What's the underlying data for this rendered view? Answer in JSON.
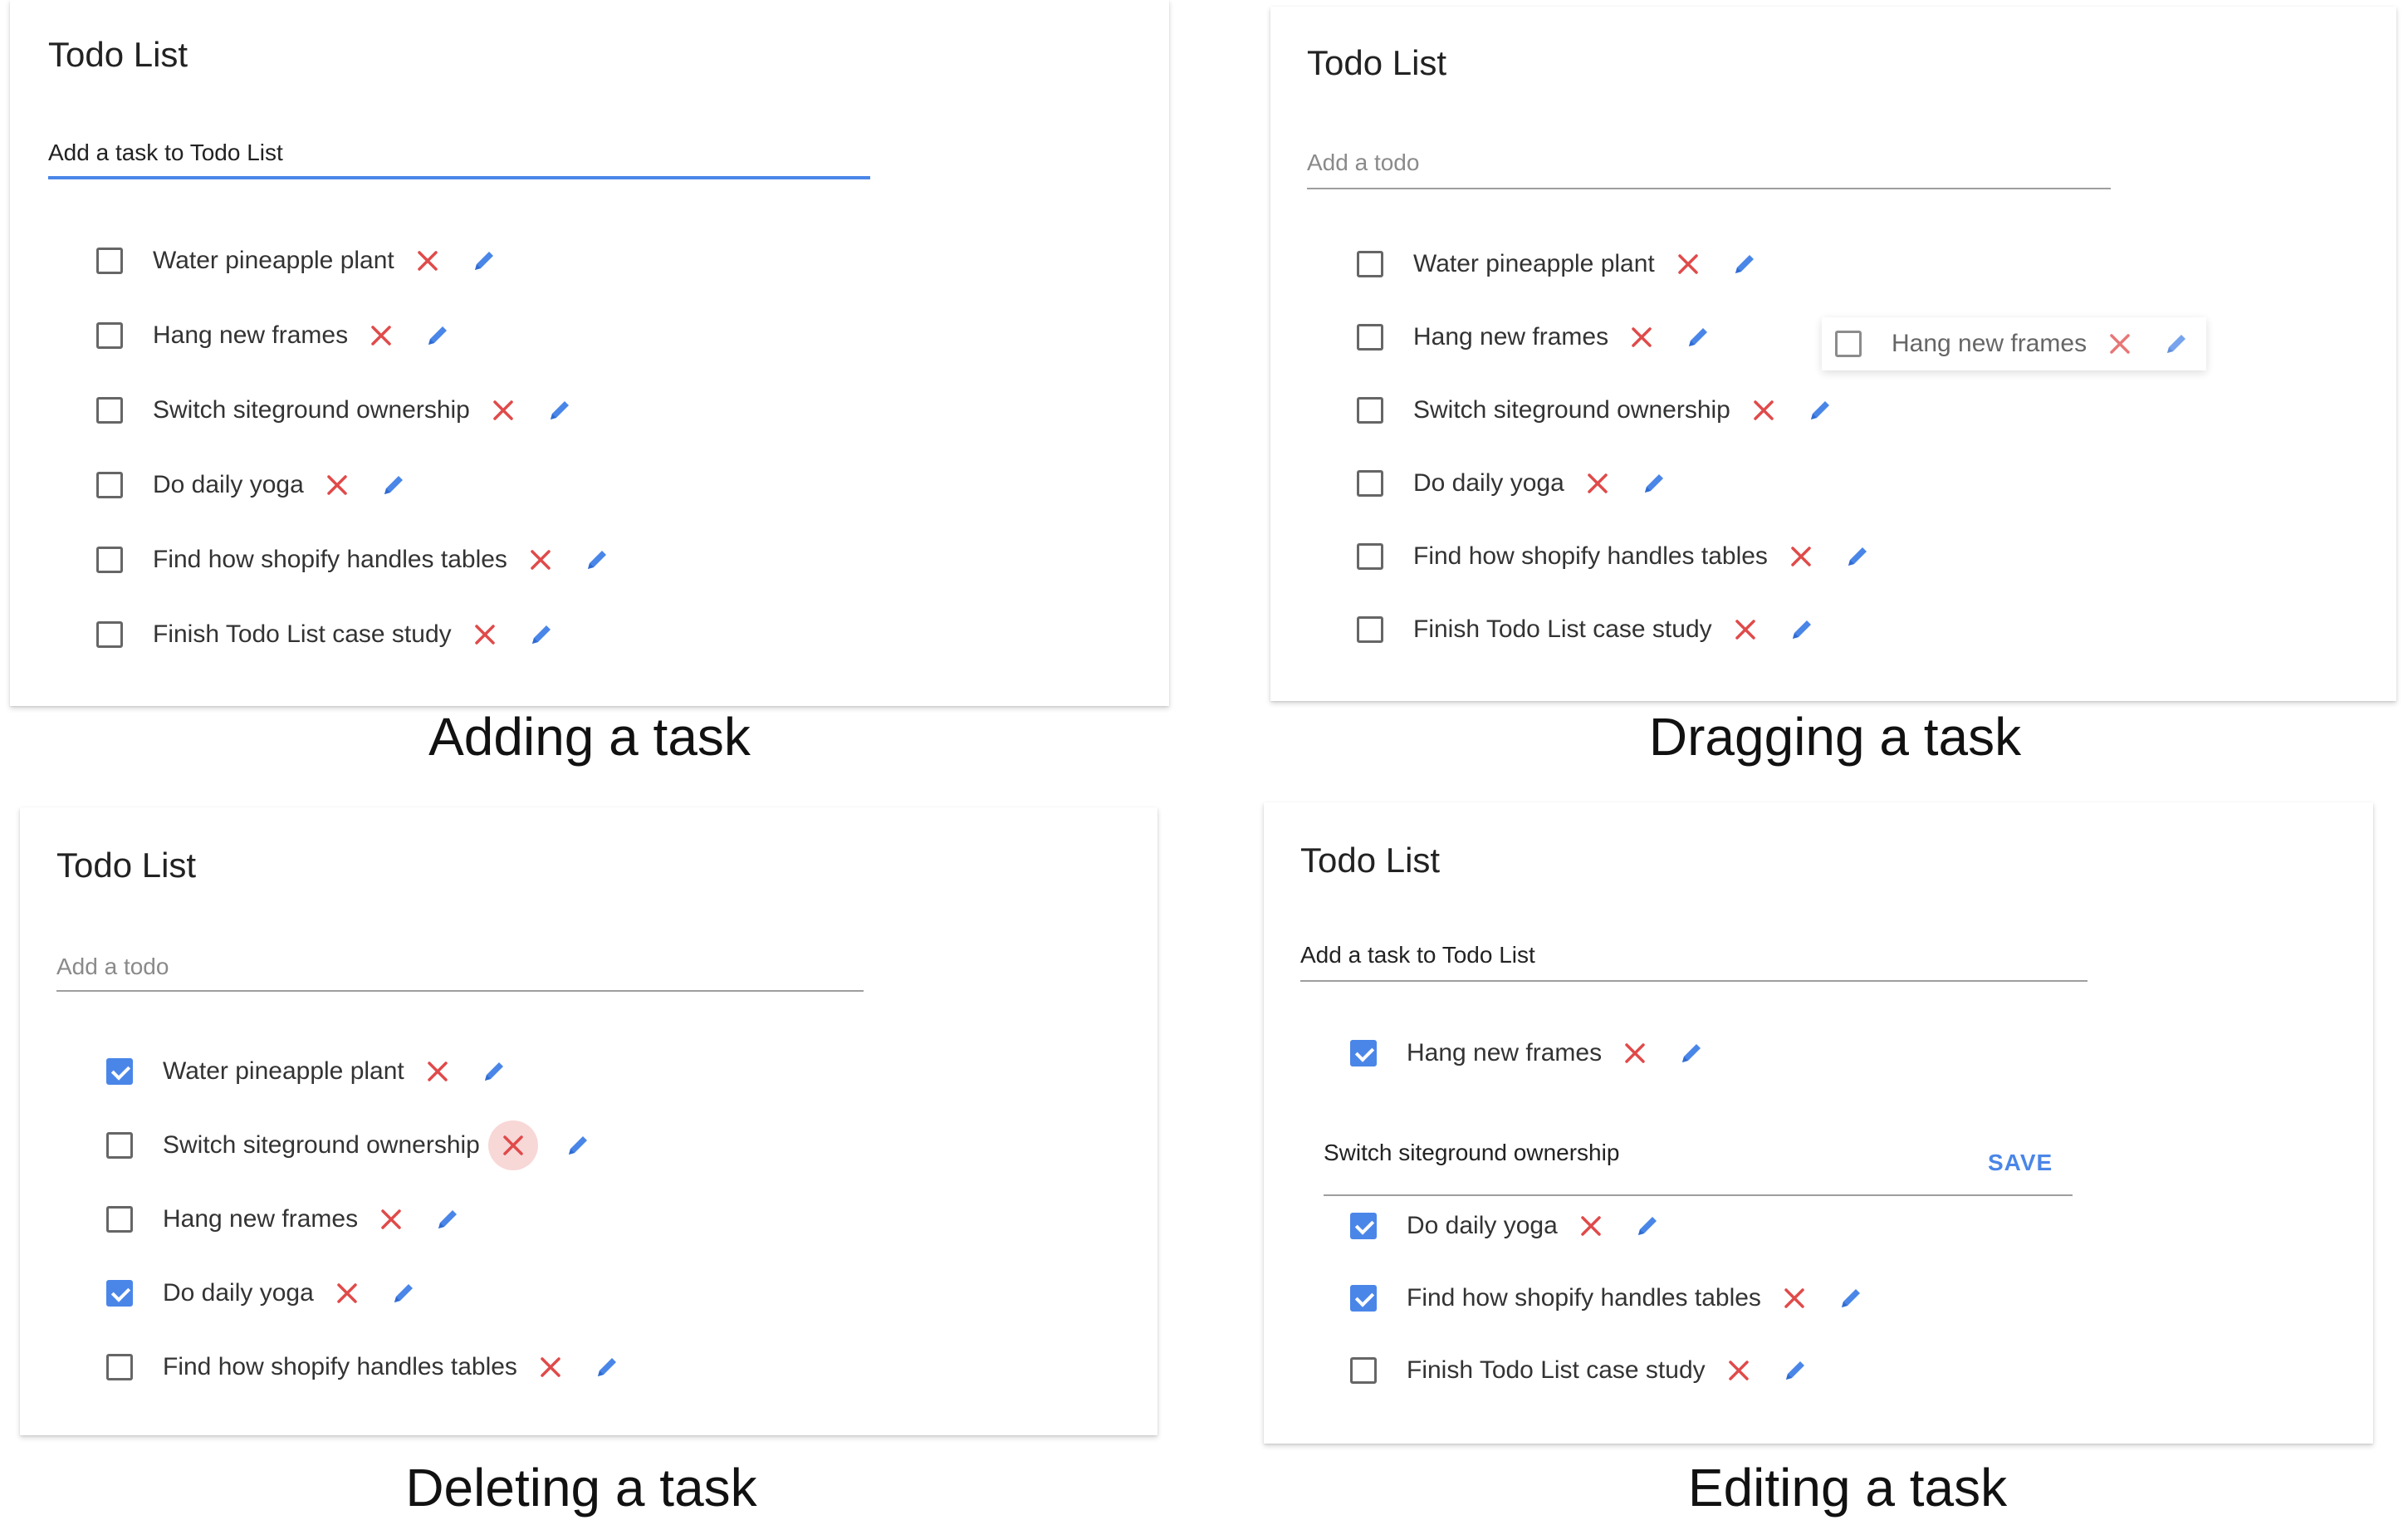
{
  "colors": {
    "accent": "#4a86e8",
    "delete": "#e04a4a",
    "checkbox": "#666666"
  },
  "panels": {
    "adding": {
      "title": "Todo List",
      "input_value": "Add a task to Todo List",
      "caption": "Adding a task",
      "tasks": [
        {
          "label": "Water pineapple plant",
          "checked": false
        },
        {
          "label": "Hang new frames",
          "checked": false
        },
        {
          "label": "Switch siteground ownership",
          "checked": false
        },
        {
          "label": "Do daily yoga",
          "checked": false
        },
        {
          "label": "Find how shopify handles tables",
          "checked": false
        },
        {
          "label": "Finish Todo List case study",
          "checked": false
        }
      ]
    },
    "dragging": {
      "title": "Todo List",
      "input_placeholder": "Add a todo",
      "caption": "Dragging a task",
      "dragged_label": "Hang new frames",
      "tasks": [
        {
          "label": "Water pineapple plant",
          "checked": false
        },
        {
          "label": "Hang new frames",
          "checked": false
        },
        {
          "label": "Switch siteground ownership",
          "checked": false
        },
        {
          "label": "Do daily yoga",
          "checked": false
        },
        {
          "label": "Find how shopify handles tables",
          "checked": false
        },
        {
          "label": "Finish Todo List case study",
          "checked": false
        }
      ]
    },
    "deleting": {
      "title": "Todo List",
      "input_placeholder": "Add a todo",
      "caption": "Deleting a task",
      "tasks": [
        {
          "label": "Water pineapple plant",
          "checked": true
        },
        {
          "label": "Switch siteground ownership",
          "checked": false
        },
        {
          "label": "Hang new frames",
          "checked": false
        },
        {
          "label": "Do daily yoga",
          "checked": true
        },
        {
          "label": "Find how shopify handles tables",
          "checked": false
        }
      ]
    },
    "editing": {
      "title": "Todo List",
      "input_value": "Add a task to Todo List",
      "caption": "Editing a task",
      "first_task": {
        "label": "Hang new frames",
        "checked": true
      },
      "edit_value": "Switch siteground ownership",
      "save_label": "SAVE",
      "tasks": [
        {
          "label": "Do daily yoga",
          "checked": true
        },
        {
          "label": "Find how shopify handles tables",
          "checked": true
        },
        {
          "label": "Finish Todo List case study",
          "checked": false
        }
      ]
    }
  }
}
